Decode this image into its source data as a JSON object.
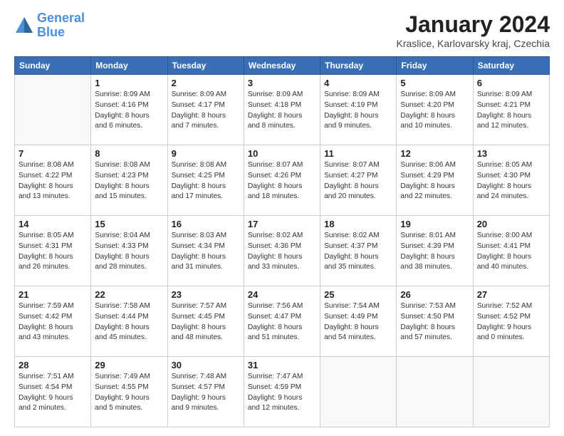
{
  "header": {
    "logo_line1": "General",
    "logo_line2": "Blue",
    "main_title": "January 2024",
    "subtitle": "Kraslice, Karlovarsky kraj, Czechia"
  },
  "weekdays": [
    "Sunday",
    "Monday",
    "Tuesday",
    "Wednesday",
    "Thursday",
    "Friday",
    "Saturday"
  ],
  "weeks": [
    [
      {
        "day": "",
        "info": ""
      },
      {
        "day": "1",
        "info": "Sunrise: 8:09 AM\nSunset: 4:16 PM\nDaylight: 8 hours\nand 6 minutes."
      },
      {
        "day": "2",
        "info": "Sunrise: 8:09 AM\nSunset: 4:17 PM\nDaylight: 8 hours\nand 7 minutes."
      },
      {
        "day": "3",
        "info": "Sunrise: 8:09 AM\nSunset: 4:18 PM\nDaylight: 8 hours\nand 8 minutes."
      },
      {
        "day": "4",
        "info": "Sunrise: 8:09 AM\nSunset: 4:19 PM\nDaylight: 8 hours\nand 9 minutes."
      },
      {
        "day": "5",
        "info": "Sunrise: 8:09 AM\nSunset: 4:20 PM\nDaylight: 8 hours\nand 10 minutes."
      },
      {
        "day": "6",
        "info": "Sunrise: 8:09 AM\nSunset: 4:21 PM\nDaylight: 8 hours\nand 12 minutes."
      }
    ],
    [
      {
        "day": "7",
        "info": "Sunrise: 8:08 AM\nSunset: 4:22 PM\nDaylight: 8 hours\nand 13 minutes."
      },
      {
        "day": "8",
        "info": "Sunrise: 8:08 AM\nSunset: 4:23 PM\nDaylight: 8 hours\nand 15 minutes."
      },
      {
        "day": "9",
        "info": "Sunrise: 8:08 AM\nSunset: 4:25 PM\nDaylight: 8 hours\nand 17 minutes."
      },
      {
        "day": "10",
        "info": "Sunrise: 8:07 AM\nSunset: 4:26 PM\nDaylight: 8 hours\nand 18 minutes."
      },
      {
        "day": "11",
        "info": "Sunrise: 8:07 AM\nSunset: 4:27 PM\nDaylight: 8 hours\nand 20 minutes."
      },
      {
        "day": "12",
        "info": "Sunrise: 8:06 AM\nSunset: 4:29 PM\nDaylight: 8 hours\nand 22 minutes."
      },
      {
        "day": "13",
        "info": "Sunrise: 8:05 AM\nSunset: 4:30 PM\nDaylight: 8 hours\nand 24 minutes."
      }
    ],
    [
      {
        "day": "14",
        "info": "Sunrise: 8:05 AM\nSunset: 4:31 PM\nDaylight: 8 hours\nand 26 minutes."
      },
      {
        "day": "15",
        "info": "Sunrise: 8:04 AM\nSunset: 4:33 PM\nDaylight: 8 hours\nand 28 minutes."
      },
      {
        "day": "16",
        "info": "Sunrise: 8:03 AM\nSunset: 4:34 PM\nDaylight: 8 hours\nand 31 minutes."
      },
      {
        "day": "17",
        "info": "Sunrise: 8:02 AM\nSunset: 4:36 PM\nDaylight: 8 hours\nand 33 minutes."
      },
      {
        "day": "18",
        "info": "Sunrise: 8:02 AM\nSunset: 4:37 PM\nDaylight: 8 hours\nand 35 minutes."
      },
      {
        "day": "19",
        "info": "Sunrise: 8:01 AM\nSunset: 4:39 PM\nDaylight: 8 hours\nand 38 minutes."
      },
      {
        "day": "20",
        "info": "Sunrise: 8:00 AM\nSunset: 4:41 PM\nDaylight: 8 hours\nand 40 minutes."
      }
    ],
    [
      {
        "day": "21",
        "info": "Sunrise: 7:59 AM\nSunset: 4:42 PM\nDaylight: 8 hours\nand 43 minutes."
      },
      {
        "day": "22",
        "info": "Sunrise: 7:58 AM\nSunset: 4:44 PM\nDaylight: 8 hours\nand 45 minutes."
      },
      {
        "day": "23",
        "info": "Sunrise: 7:57 AM\nSunset: 4:45 PM\nDaylight: 8 hours\nand 48 minutes."
      },
      {
        "day": "24",
        "info": "Sunrise: 7:56 AM\nSunset: 4:47 PM\nDaylight: 8 hours\nand 51 minutes."
      },
      {
        "day": "25",
        "info": "Sunrise: 7:54 AM\nSunset: 4:49 PM\nDaylight: 8 hours\nand 54 minutes."
      },
      {
        "day": "26",
        "info": "Sunrise: 7:53 AM\nSunset: 4:50 PM\nDaylight: 8 hours\nand 57 minutes."
      },
      {
        "day": "27",
        "info": "Sunrise: 7:52 AM\nSunset: 4:52 PM\nDaylight: 9 hours\nand 0 minutes."
      }
    ],
    [
      {
        "day": "28",
        "info": "Sunrise: 7:51 AM\nSunset: 4:54 PM\nDaylight: 9 hours\nand 2 minutes."
      },
      {
        "day": "29",
        "info": "Sunrise: 7:49 AM\nSunset: 4:55 PM\nDaylight: 9 hours\nand 5 minutes."
      },
      {
        "day": "30",
        "info": "Sunrise: 7:48 AM\nSunset: 4:57 PM\nDaylight: 9 hours\nand 9 minutes."
      },
      {
        "day": "31",
        "info": "Sunrise: 7:47 AM\nSunset: 4:59 PM\nDaylight: 9 hours\nand 12 minutes."
      },
      {
        "day": "",
        "info": ""
      },
      {
        "day": "",
        "info": ""
      },
      {
        "day": "",
        "info": ""
      }
    ]
  ]
}
